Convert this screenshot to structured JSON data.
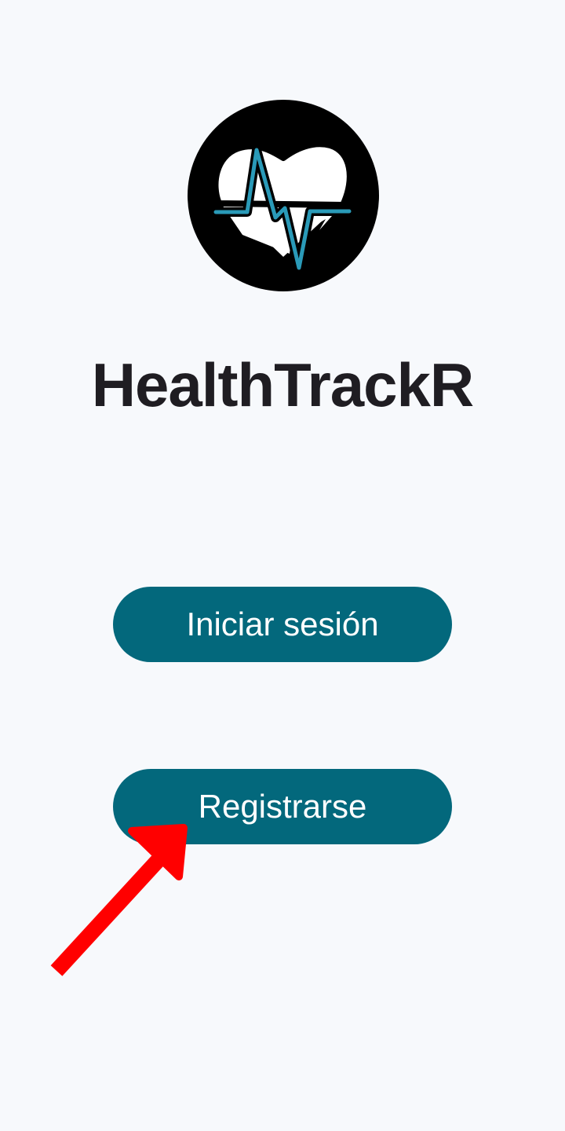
{
  "app": {
    "title": "HealthTrackR"
  },
  "actions": {
    "login_label": "Iniciar sesión",
    "register_label": "Registrarse"
  },
  "logo": {
    "icon": "heart-pulse-icon"
  },
  "annotation": {
    "icon": "red-arrow-icon",
    "target": "register-button"
  },
  "colors": {
    "background": "#f7f9fc",
    "button": "#03687c",
    "button_text": "#ffffff",
    "title_text": "#1f1d22",
    "logo_circle": "#000000",
    "pulse_line": "#2a9ab8",
    "arrow": "#ff0000"
  }
}
